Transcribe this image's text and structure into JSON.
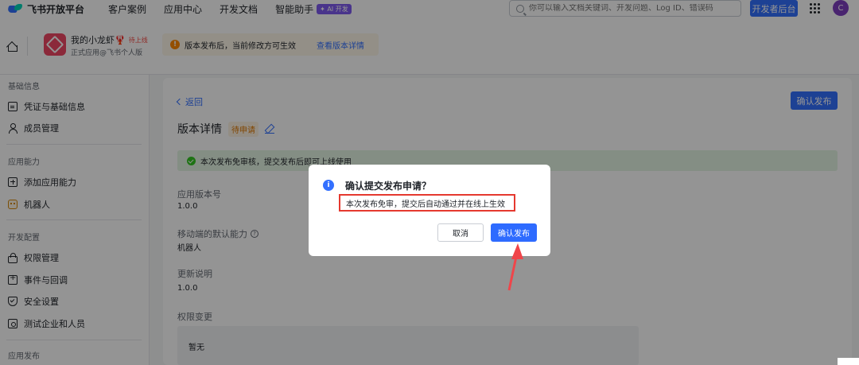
{
  "topnav": {
    "logo_text": "飞书开放平台",
    "items": [
      {
        "label": "客户案例"
      },
      {
        "label": "应用中心"
      },
      {
        "label": "开发文档"
      },
      {
        "label": "智能助手",
        "badge": "✦ AI 开发"
      }
    ],
    "search_placeholder": "你可以输入文档关键词、开发问题、Log ID、错误码",
    "dev_button": "开发者后台",
    "avatar_letter": "C"
  },
  "app": {
    "name": "我的小龙虾🦞",
    "status": "待上线",
    "subtitle": "正式应用@飞书个人版"
  },
  "notice": {
    "icon": "!",
    "text": "版本发布后，当前修改方可生效",
    "link": "查看版本详情"
  },
  "sidebar": {
    "sections": [
      {
        "title": "基础信息",
        "items": [
          {
            "label": "凭证与基础信息",
            "icon": "card-icon"
          },
          {
            "label": "成员管理",
            "icon": "user-icon"
          }
        ]
      },
      {
        "title": "应用能力",
        "items": [
          {
            "label": "添加应用能力",
            "icon": "add-icon"
          },
          {
            "label": "机器人",
            "icon": "bot-icon"
          }
        ]
      },
      {
        "title": "开发配置",
        "items": [
          {
            "label": "权限管理",
            "icon": "lock-icon"
          },
          {
            "label": "事件与回调",
            "icon": "event-icon"
          },
          {
            "label": "安全设置",
            "icon": "shield-icon"
          },
          {
            "label": "测试企业和人员",
            "icon": "test-icon"
          }
        ]
      },
      {
        "title": "应用发布",
        "items": []
      }
    ]
  },
  "main": {
    "back": "返回",
    "confirm_button": "确认发布",
    "title": "版本详情",
    "pending_badge": "待申请",
    "success_text": "本次发布免审核，提交发布后即可上线使用",
    "fields": {
      "version_label": "应用版本号",
      "version_value": "1.0.0",
      "mobile_label": "移动端的默认能力",
      "mobile_value": "机器人",
      "update_label": "更新说明",
      "update_value": "1.0.0",
      "perm_label": "权限变更",
      "perm_value": "暂无"
    }
  },
  "modal": {
    "icon": "i",
    "title": "确认提交发布申请？",
    "body": "本次发布免审，提交后自动通过并在线上生效",
    "cancel": "取消",
    "confirm": "确认发布"
  },
  "colors": {
    "primary": "#3370ff",
    "highlight": "#e5392f",
    "success": "#34c724"
  }
}
